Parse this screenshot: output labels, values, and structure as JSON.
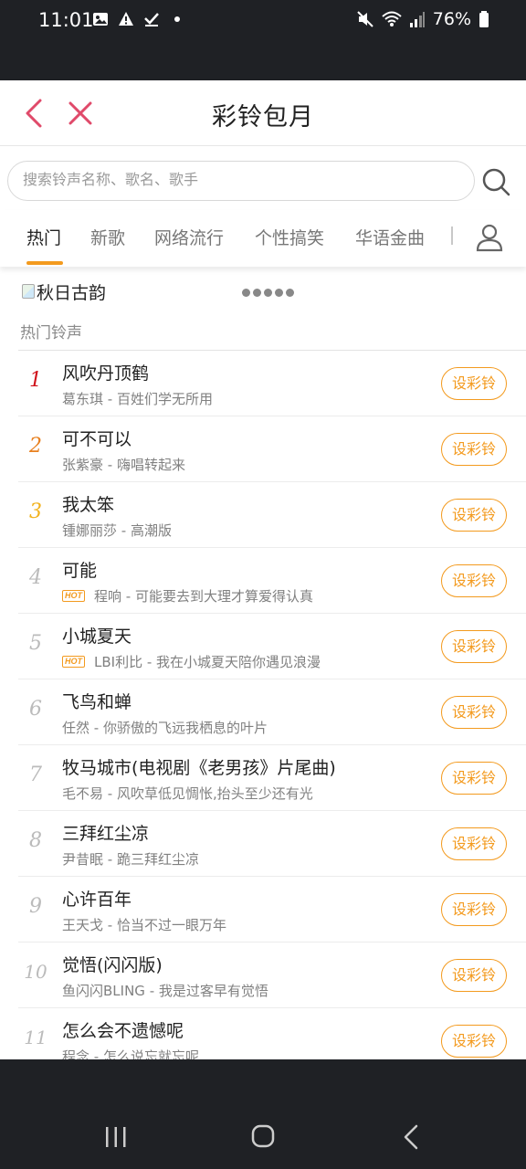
{
  "status_bar": {
    "time": "11:01",
    "battery": "76%",
    "left_icons": [
      "image-icon",
      "warning-icon",
      "check-icon",
      "dot-icon"
    ],
    "right_icons": [
      "mute-icon",
      "wifi-icon",
      "signal-icon",
      "battery-icon"
    ]
  },
  "header": {
    "title": "彩铃包月"
  },
  "search": {
    "placeholder": "搜索铃声名称、歌名、歌手"
  },
  "tabs": [
    {
      "label": "热门",
      "active": true
    },
    {
      "label": "新歌",
      "active": false
    },
    {
      "label": "网络流行",
      "active": false
    },
    {
      "label": "个性搞笑",
      "active": false
    },
    {
      "label": "华语金曲",
      "active": false
    }
  ],
  "banner": {
    "alt_text": "秋日古韵",
    "dots": 5
  },
  "section": {
    "title": "热门铃声"
  },
  "button_label": "设彩铃",
  "songs": [
    {
      "rank": "1",
      "title": "风吹丹顶鹤",
      "artist": "葛东琪",
      "album": "百姓们学无所用",
      "hot": false
    },
    {
      "rank": "2",
      "title": "可不可以",
      "artist": "张紫豪",
      "album": "嗨唱转起来",
      "hot": false
    },
    {
      "rank": "3",
      "title": "我太笨",
      "artist": "锺娜丽莎",
      "album": "高潮版",
      "hot": false
    },
    {
      "rank": "4",
      "title": "可能",
      "artist": "程响",
      "album": "可能要去到大理才算爱得认真",
      "hot": true
    },
    {
      "rank": "5",
      "title": "小城夏天",
      "artist": "LBI利比",
      "album": "我在小城夏天陪你遇见浪漫",
      "hot": true
    },
    {
      "rank": "6",
      "title": "飞鸟和蝉",
      "artist": "任然",
      "album": "你骄傲的飞远我栖息的叶片",
      "hot": false
    },
    {
      "rank": "7",
      "title": "牧马城市(电视剧《老男孩》片尾曲)",
      "artist": "毛不易",
      "album": "风吹草低见惆怅,抬头至少还有光",
      "hot": false
    },
    {
      "rank": "8",
      "title": "三拜红尘凉",
      "artist": "尹昔眠",
      "album": "跪三拜红尘凉",
      "hot": false
    },
    {
      "rank": "9",
      "title": "心许百年",
      "artist": "王天戈",
      "album": "恰当不过一眼万年",
      "hot": false
    },
    {
      "rank": "10",
      "title": "觉悟(闪闪版)",
      "artist": "鱼闪闪BLING",
      "album": "我是过客早有觉悟",
      "hot": false
    },
    {
      "rank": "11",
      "title": "怎么会不遗憾呢",
      "artist": "程念",
      "album": "怎么说忘就忘呢",
      "hot": false
    }
  ],
  "hot_badge": "HOT",
  "colors": {
    "accent": "#f39a1e",
    "back_close": "#e04a6a",
    "rank1": "#d0121b",
    "rank2": "#e8801f",
    "rank3": "#f2b21e",
    "rank_other": "#bbbbbb"
  }
}
